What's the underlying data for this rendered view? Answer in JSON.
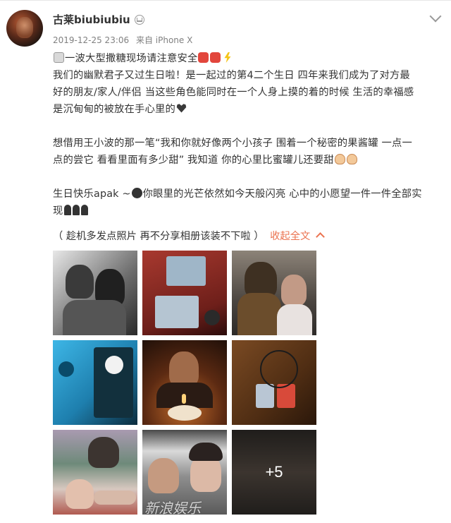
{
  "post": {
    "username": "古莱biubiubiu",
    "timestamp": "2019-12-25 23:06",
    "source": "来自 iPhone X",
    "lines": [
      "一波大型撒糖现场请注意安全",
      "我们的幽默君子又过生日啦！是一起过的第4二个生日  四年来我们成为了对方最",
      "好的朋友/家人/伴侣 当这些角色能同时在一个人身上摸的着的时候 生活的幸福感",
      "是沉甸甸的被放在手心里的",
      "想借用王小波的那一笔“我和你就好像两个小孩子 围着一个秘密的果酱罐 一点一",
      "点的尝它 看看里面有多少甜” 我知道 你的心里比蜜罐儿还要甜",
      "生日快乐apak ~",
      "你眼里的光芒依然如今天般闪亮 心中的小愿望一件一件全部实",
      "现"
    ],
    "collapse_note": "（ 趁机多发点照片 再不分享相册该装不下啦 ）",
    "collapse_link": "收起全文",
    "more_count": "+5",
    "watermark": "新浪娱乐"
  },
  "icons": {
    "verified": "crown-badge-icon",
    "expand": "chevron-down-icon",
    "collapse": "chevron-up-icon"
  },
  "colors": {
    "accent": "#eb7350",
    "meta": "#808080",
    "text": "#333333"
  }
}
